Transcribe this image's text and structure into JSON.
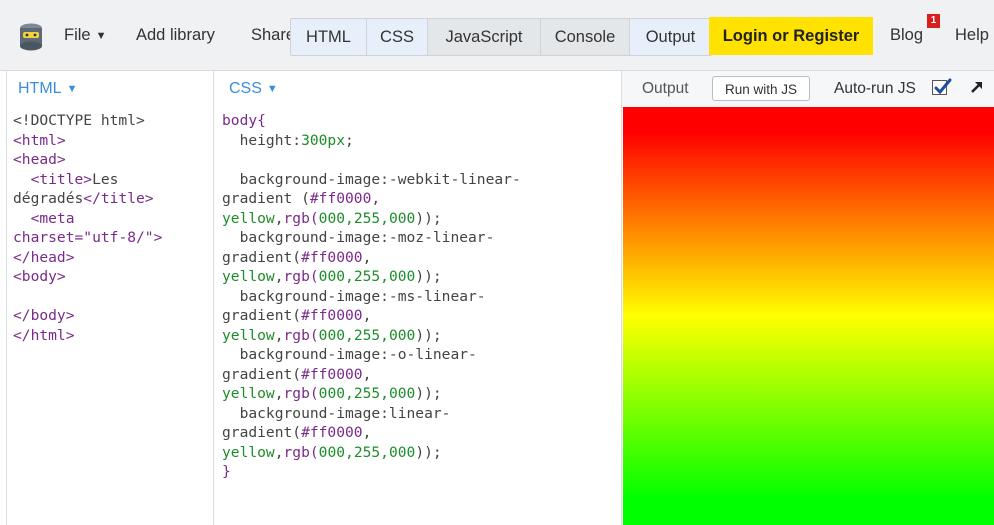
{
  "toolbar": {
    "file_label": "File",
    "add_library_label": "Add library",
    "share_label": "Share",
    "tabs": [
      {
        "label": "HTML"
      },
      {
        "label": "CSS"
      },
      {
        "label": "JavaScript"
      },
      {
        "label": "Console"
      },
      {
        "label": "Output"
      }
    ],
    "login_label": "Login or Register",
    "blog_label": "Blog",
    "blog_badge": "1",
    "help_label": "Help"
  },
  "html_panel": {
    "header": "HTML"
  },
  "css_panel": {
    "header": "CSS"
  },
  "output_panel": {
    "label": "Output",
    "run_button": "Run with JS",
    "autorun_label": "Auto-run JS",
    "autorun_checked": true
  },
  "html_code": [
    [
      {
        "t": "<!DOCTYPE html>",
        "c": "punc"
      }
    ],
    [
      {
        "t": "<html>",
        "c": "tag"
      }
    ],
    [
      {
        "t": "<head>",
        "c": "tag"
      }
    ],
    [
      {
        "t": "  ",
        "c": "punc"
      },
      {
        "t": "<title>",
        "c": "tag"
      },
      {
        "t": "Les",
        "c": "punc"
      }
    ],
    [
      {
        "t": "dégradés",
        "c": "punc"
      },
      {
        "t": "</title>",
        "c": "tag"
      }
    ],
    [
      {
        "t": "  ",
        "c": "punc"
      },
      {
        "t": "<meta",
        "c": "tag"
      }
    ],
    [
      {
        "t": "charset=",
        "c": "attr"
      },
      {
        "t": "\"utf-8/\">",
        "c": "str"
      }
    ],
    [
      {
        "t": "</head>",
        "c": "tag"
      }
    ],
    [
      {
        "t": "<body>",
        "c": "tag"
      }
    ],
    [
      {
        "t": "",
        "c": "punc"
      }
    ],
    [
      {
        "t": "</body>",
        "c": "tag"
      }
    ],
    [
      {
        "t": "</html>",
        "c": "tag"
      }
    ]
  ],
  "css_code": [
    [
      {
        "t": "body{",
        "c": "kw"
      }
    ],
    [
      {
        "t": "  height:",
        "c": "prop"
      },
      {
        "t": "300px",
        "c": "num"
      },
      {
        "t": ";",
        "c": "punc"
      }
    ],
    [
      {
        "t": "",
        "c": "punc"
      }
    ],
    [
      {
        "t": "  background-image:-webkit-linear-",
        "c": "prop"
      }
    ],
    [
      {
        "t": "gradient (",
        "c": "prop"
      },
      {
        "t": "#ff0000",
        "c": "kw"
      },
      {
        "t": ",",
        "c": "punc"
      }
    ],
    [
      {
        "t": "yellow",
        "c": "num"
      },
      {
        "t": ",",
        "c": "punc"
      },
      {
        "t": "rgb(",
        "c": "kw"
      },
      {
        "t": "000,255,000",
        "c": "num"
      },
      {
        "t": "));",
        "c": "punc"
      }
    ],
    [
      {
        "t": "  background-image:-moz-linear-",
        "c": "prop"
      }
    ],
    [
      {
        "t": "gradient(",
        "c": "prop"
      },
      {
        "t": "#ff0000",
        "c": "kw"
      },
      {
        "t": ",",
        "c": "punc"
      }
    ],
    [
      {
        "t": "yellow",
        "c": "num"
      },
      {
        "t": ",",
        "c": "punc"
      },
      {
        "t": "rgb(",
        "c": "kw"
      },
      {
        "t": "000,255,000",
        "c": "num"
      },
      {
        "t": "));",
        "c": "punc"
      }
    ],
    [
      {
        "t": "  background-image:-ms-linear-",
        "c": "prop"
      }
    ],
    [
      {
        "t": "gradient(",
        "c": "prop"
      },
      {
        "t": "#ff0000",
        "c": "kw"
      },
      {
        "t": ",",
        "c": "punc"
      }
    ],
    [
      {
        "t": "yellow",
        "c": "num"
      },
      {
        "t": ",",
        "c": "punc"
      },
      {
        "t": "rgb(",
        "c": "kw"
      },
      {
        "t": "000,255,000",
        "c": "num"
      },
      {
        "t": "));",
        "c": "punc"
      }
    ],
    [
      {
        "t": "  background-image:-o-linear-",
        "c": "prop"
      }
    ],
    [
      {
        "t": "gradient(",
        "c": "prop"
      },
      {
        "t": "#ff0000",
        "c": "kw"
      },
      {
        "t": ",",
        "c": "punc"
      }
    ],
    [
      {
        "t": "yellow",
        "c": "num"
      },
      {
        "t": ",",
        "c": "punc"
      },
      {
        "t": "rgb(",
        "c": "kw"
      },
      {
        "t": "000,255,000",
        "c": "num"
      },
      {
        "t": "));",
        "c": "punc"
      }
    ],
    [
      {
        "t": "  background-image:linear-",
        "c": "prop"
      }
    ],
    [
      {
        "t": "gradient(",
        "c": "prop"
      },
      {
        "t": "#ff0000",
        "c": "kw"
      },
      {
        "t": ",",
        "c": "punc"
      }
    ],
    [
      {
        "t": "yellow",
        "c": "num"
      },
      {
        "t": ",",
        "c": "punc"
      },
      {
        "t": "rgb(",
        "c": "kw"
      },
      {
        "t": "000,255,000",
        "c": "num"
      },
      {
        "t": "));",
        "c": "punc"
      }
    ],
    [
      {
        "t": "}",
        "c": "kw"
      }
    ]
  ],
  "colors": {
    "accent_blue": "#3b8ddb",
    "login_yellow": "#ffe200",
    "syntax_tag": "#7a2a8a",
    "syntax_value": "#1d8d2a",
    "badge_red": "#d81e1e"
  }
}
